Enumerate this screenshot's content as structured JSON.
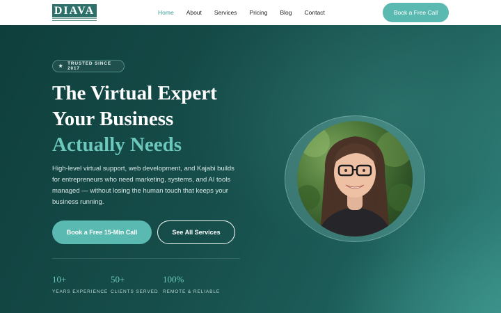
{
  "header": {
    "logo_text": "DIAVA",
    "nav": [
      {
        "label": "Home",
        "active": true
      },
      {
        "label": "About",
        "active": false
      },
      {
        "label": "Services",
        "active": false
      },
      {
        "label": "Pricing",
        "active": false
      },
      {
        "label": "Blog",
        "active": false
      },
      {
        "label": "Contact",
        "active": false
      }
    ],
    "cta_label": "Book a Free Call"
  },
  "hero": {
    "badge_icon": "star-icon",
    "badge_label": "TRUSTED SINCE 2017",
    "headline_line1": "The Virtual Expert",
    "headline_line2": "Your Business",
    "headline_accent": "Actually Needs",
    "lede": "High-level virtual support, web development, and Kajabi builds for entrepreneurs who need marketing, systems, and AI tools managed — without losing the human touch that keeps your business running.",
    "primary_button": "Book a Free 15-Min Call",
    "secondary_button": "See All Services",
    "stats": [
      {
        "value": "10+",
        "label": "YEARS EXPERIENCE"
      },
      {
        "value": "50+",
        "label": "CLIENTS SERVED"
      },
      {
        "value": "100%",
        "label": "REMOTE & RELIABLE"
      }
    ]
  },
  "colors": {
    "accent": "#5ab9b0",
    "accent_text": "#6cc7bc",
    "hero_dark": "#0f3f3d",
    "nav_active": "#3a9c96"
  }
}
